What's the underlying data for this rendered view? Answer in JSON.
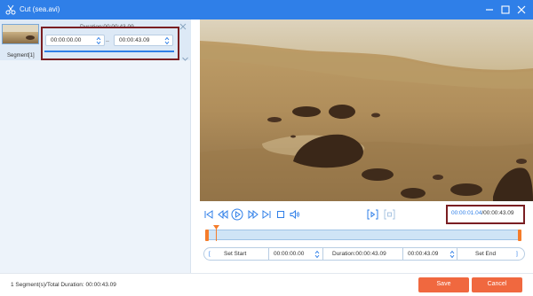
{
  "window": {
    "title": "Cut (sea.avi)",
    "icon": "scissors-icon",
    "controls": [
      "minimize-icon",
      "maximize-icon",
      "close-icon"
    ],
    "accent_color": "#2f7fe8"
  },
  "segment": {
    "label": "Segment[1]",
    "duration_label": "Duration:00:00:43.09",
    "start_time": "00:00:00.00",
    "end_time": "00:00:43.09",
    "dash": "–"
  },
  "player": {
    "current_time": "00:00:01.04",
    "separator": "/",
    "total_time": "00:00:43.09",
    "controls": [
      "skip-start-icon",
      "step-back-icon",
      "play-icon",
      "step-forward-icon",
      "skip-end-icon",
      "stop-icon",
      "volume-icon"
    ],
    "playhead_fraction": 0.024
  },
  "cutbar": {
    "set_start_label": "Set Start",
    "start_value": "00:00:00.00",
    "duration_value": "Duration:00:00:43.09",
    "end_value": "00:00:43.09",
    "set_end_label": "Set End"
  },
  "footer": {
    "summary": "1 Segment(s)/Total Duration: 00:00:43.09",
    "save_label": "Save",
    "cancel_label": "Cancel",
    "button_color": "#f0683f"
  }
}
